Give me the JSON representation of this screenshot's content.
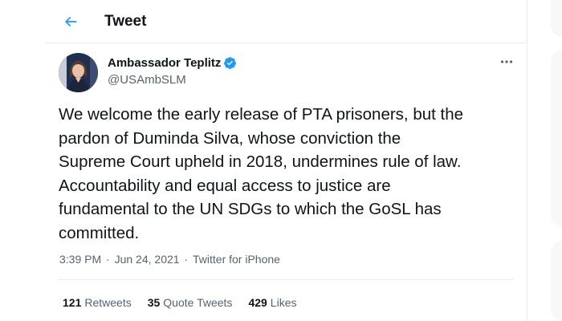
{
  "header": {
    "title": "Tweet",
    "back_icon": "arrow-left-icon"
  },
  "author": {
    "name": "Ambassador Teplitz",
    "handle": "@USAmbSLM",
    "verified": true,
    "avatar_icon": "profile-photo"
  },
  "tweet": {
    "text": "We welcome the early release of PTA prisoners, but the\npardon of Duminda Silva, whose conviction the\nSupreme Court upheld in 2018, undermines rule of law.\nAccountability and equal access to justice are\nfundamental to the UN SDGs to which the GoSL has\ncommitted.",
    "time": "3:39 PM",
    "date": "Jun 24, 2021",
    "source": "Twitter for iPhone"
  },
  "stats": {
    "retweets_count": "121",
    "retweets_label": "Retweets",
    "quotes_count": "35",
    "quotes_label": "Quote Tweets",
    "likes_count": "429",
    "likes_label": "Likes"
  },
  "colors": {
    "accent": "#1d9bf0",
    "text": "#0f1419",
    "secondary": "#536471",
    "border": "#ebeef0"
  }
}
